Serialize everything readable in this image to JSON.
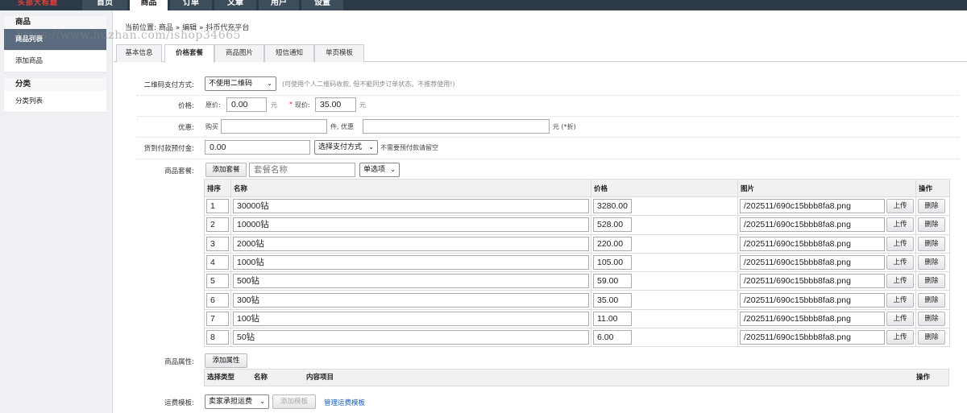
{
  "logo": {
    "text": "头部大标题"
  },
  "nav": {
    "tabs": [
      {
        "label": "首页"
      },
      {
        "label": "商品"
      },
      {
        "label": "订单"
      },
      {
        "label": "文章"
      },
      {
        "label": "用户"
      },
      {
        "label": "设置"
      }
    ],
    "active_index": 1
  },
  "sidebar": {
    "group1_title": "商品",
    "item_list": "商品列表",
    "item_add": "添加商品",
    "group2_title": "分类",
    "item_category": "分类列表"
  },
  "breadcrumb": {
    "text": "当前位置: 商品 » 编辑 » 抖币代充平台"
  },
  "watermark": {
    "text": "https://www.huzhan.com/ishop34665"
  },
  "tabs": [
    {
      "label": "基本信息"
    },
    {
      "label": "价格套餐"
    },
    {
      "label": "商品图片"
    },
    {
      "label": "短信通知"
    },
    {
      "label": "单页模板"
    }
  ],
  "form": {
    "qr_label": "二维码支付方式:",
    "qr_value": "不使用二维码",
    "qr_hint": "(可使用个人二维码收款, 但不能同步订单状态。不推荐使用!)",
    "price_label": "价格:",
    "orig_label": "原价:",
    "orig_value": "0.00",
    "unit1": "元",
    "star": "*",
    "now_label": "现价:",
    "now_value": "35.00",
    "unit2": "元",
    "discount_label": "优惠:",
    "buy_label": "购买",
    "piece_label": "件, 优惠",
    "discount_unit": "元 (*折)",
    "cod_label": "货到付款预付金:",
    "cod_value": "0.00",
    "cod_method": "选择支付方式",
    "cod_hint": "不需要预付款请留空",
    "package_label": "商品套餐:",
    "add_package_btn": "添加套餐",
    "package_name_placeholder": "套餐名称",
    "package_type": "单选项",
    "attr_label": "商品属性:",
    "add_attr_btn": "添加属性",
    "shipping_label": "运费模板:",
    "shipping_value": "卖家承担运费",
    "add_template_btn": "添加模板",
    "manage_template_link": "管理运费模板"
  },
  "package_table": {
    "headers": {
      "order": "排序",
      "name": "名称",
      "price": "价格",
      "image": "图片",
      "action": "操作"
    },
    "upload_label": "上传",
    "delete_label": "删除",
    "rows": [
      {
        "order": "1",
        "name": "30000钻",
        "price": "3280.00",
        "image": "/202511/690c15bbb8fa8.png"
      },
      {
        "order": "2",
        "name": "10000钻",
        "price": "528.00",
        "image": "/202511/690c15bbb8fa8.png"
      },
      {
        "order": "3",
        "name": "2000钻",
        "price": "220.00",
        "image": "/202511/690c15bbb8fa8.png"
      },
      {
        "order": "4",
        "name": "1000钻",
        "price": "105.00",
        "image": "/202511/690c15bbb8fa8.png"
      },
      {
        "order": "5",
        "name": "500钻",
        "price": "59.00",
        "image": "/202511/690c15bbb8fa8.png"
      },
      {
        "order": "6",
        "name": "300钻",
        "price": "35.00",
        "image": "/202511/690c15bbb8fa8.png"
      },
      {
        "order": "7",
        "name": "100钻",
        "price": "11.00",
        "image": "/202511/690c15bbb8fa8.png"
      },
      {
        "order": "8",
        "name": "50钻",
        "price": "6.00",
        "image": "/202511/690c15bbb8fa8.png"
      }
    ]
  },
  "attr_table": {
    "headers": {
      "type": "选择类型",
      "name": "名称",
      "content": "内容项目",
      "action": "操作"
    }
  }
}
